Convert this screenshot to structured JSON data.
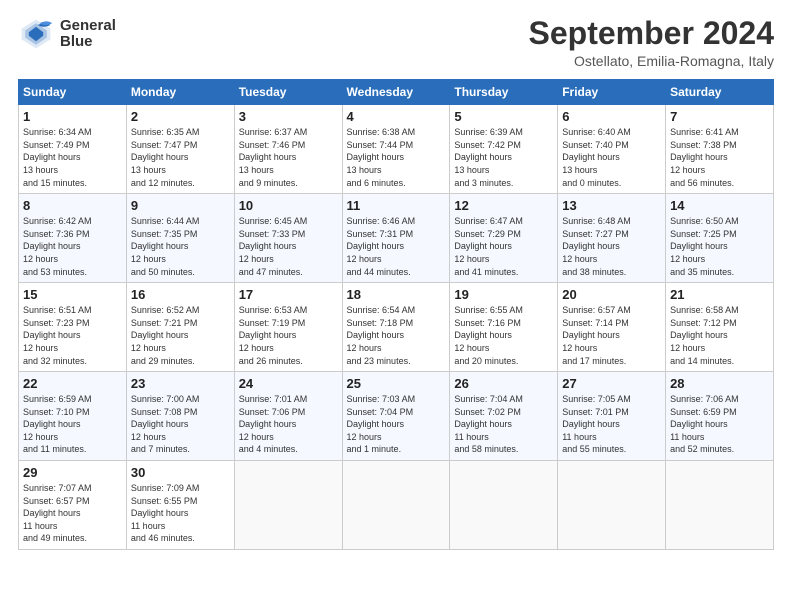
{
  "logo": {
    "line1": "General",
    "line2": "Blue"
  },
  "title": "September 2024",
  "subtitle": "Ostellato, Emilia-Romagna, Italy",
  "columns": [
    "Sunday",
    "Monday",
    "Tuesday",
    "Wednesday",
    "Thursday",
    "Friday",
    "Saturday"
  ],
  "weeks": [
    [
      {
        "day": "1",
        "sunrise": "6:34 AM",
        "sunset": "7:49 PM",
        "daylight": "13 hours and 15 minutes."
      },
      {
        "day": "2",
        "sunrise": "6:35 AM",
        "sunset": "7:47 PM",
        "daylight": "13 hours and 12 minutes."
      },
      {
        "day": "3",
        "sunrise": "6:37 AM",
        "sunset": "7:46 PM",
        "daylight": "13 hours and 9 minutes."
      },
      {
        "day": "4",
        "sunrise": "6:38 AM",
        "sunset": "7:44 PM",
        "daylight": "13 hours and 6 minutes."
      },
      {
        "day": "5",
        "sunrise": "6:39 AM",
        "sunset": "7:42 PM",
        "daylight": "13 hours and 3 minutes."
      },
      {
        "day": "6",
        "sunrise": "6:40 AM",
        "sunset": "7:40 PM",
        "daylight": "13 hours and 0 minutes."
      },
      {
        "day": "7",
        "sunrise": "6:41 AM",
        "sunset": "7:38 PM",
        "daylight": "12 hours and 56 minutes."
      }
    ],
    [
      {
        "day": "8",
        "sunrise": "6:42 AM",
        "sunset": "7:36 PM",
        "daylight": "12 hours and 53 minutes."
      },
      {
        "day": "9",
        "sunrise": "6:44 AM",
        "sunset": "7:35 PM",
        "daylight": "12 hours and 50 minutes."
      },
      {
        "day": "10",
        "sunrise": "6:45 AM",
        "sunset": "7:33 PM",
        "daylight": "12 hours and 47 minutes."
      },
      {
        "day": "11",
        "sunrise": "6:46 AM",
        "sunset": "7:31 PM",
        "daylight": "12 hours and 44 minutes."
      },
      {
        "day": "12",
        "sunrise": "6:47 AM",
        "sunset": "7:29 PM",
        "daylight": "12 hours and 41 minutes."
      },
      {
        "day": "13",
        "sunrise": "6:48 AM",
        "sunset": "7:27 PM",
        "daylight": "12 hours and 38 minutes."
      },
      {
        "day": "14",
        "sunrise": "6:50 AM",
        "sunset": "7:25 PM",
        "daylight": "12 hours and 35 minutes."
      }
    ],
    [
      {
        "day": "15",
        "sunrise": "6:51 AM",
        "sunset": "7:23 PM",
        "daylight": "12 hours and 32 minutes."
      },
      {
        "day": "16",
        "sunrise": "6:52 AM",
        "sunset": "7:21 PM",
        "daylight": "12 hours and 29 minutes."
      },
      {
        "day": "17",
        "sunrise": "6:53 AM",
        "sunset": "7:19 PM",
        "daylight": "12 hours and 26 minutes."
      },
      {
        "day": "18",
        "sunrise": "6:54 AM",
        "sunset": "7:18 PM",
        "daylight": "12 hours and 23 minutes."
      },
      {
        "day": "19",
        "sunrise": "6:55 AM",
        "sunset": "7:16 PM",
        "daylight": "12 hours and 20 minutes."
      },
      {
        "day": "20",
        "sunrise": "6:57 AM",
        "sunset": "7:14 PM",
        "daylight": "12 hours and 17 minutes."
      },
      {
        "day": "21",
        "sunrise": "6:58 AM",
        "sunset": "7:12 PM",
        "daylight": "12 hours and 14 minutes."
      }
    ],
    [
      {
        "day": "22",
        "sunrise": "6:59 AM",
        "sunset": "7:10 PM",
        "daylight": "12 hours and 11 minutes."
      },
      {
        "day": "23",
        "sunrise": "7:00 AM",
        "sunset": "7:08 PM",
        "daylight": "12 hours and 7 minutes."
      },
      {
        "day": "24",
        "sunrise": "7:01 AM",
        "sunset": "7:06 PM",
        "daylight": "12 hours and 4 minutes."
      },
      {
        "day": "25",
        "sunrise": "7:03 AM",
        "sunset": "7:04 PM",
        "daylight": "12 hours and 1 minute."
      },
      {
        "day": "26",
        "sunrise": "7:04 AM",
        "sunset": "7:02 PM",
        "daylight": "11 hours and 58 minutes."
      },
      {
        "day": "27",
        "sunrise": "7:05 AM",
        "sunset": "7:01 PM",
        "daylight": "11 hours and 55 minutes."
      },
      {
        "day": "28",
        "sunrise": "7:06 AM",
        "sunset": "6:59 PM",
        "daylight": "11 hours and 52 minutes."
      }
    ],
    [
      {
        "day": "29",
        "sunrise": "7:07 AM",
        "sunset": "6:57 PM",
        "daylight": "11 hours and 49 minutes."
      },
      {
        "day": "30",
        "sunrise": "7:09 AM",
        "sunset": "6:55 PM",
        "daylight": "11 hours and 46 minutes."
      },
      null,
      null,
      null,
      null,
      null
    ]
  ]
}
